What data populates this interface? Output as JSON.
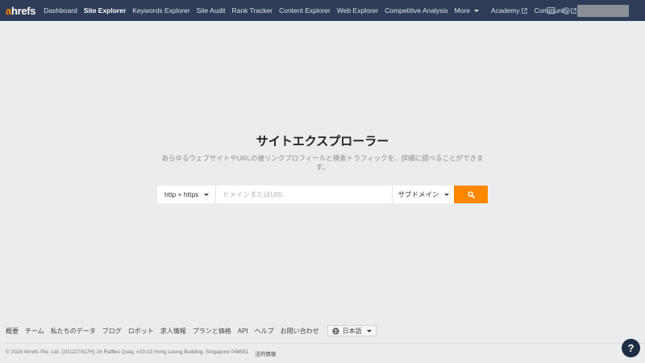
{
  "nav": {
    "logo_a": "a",
    "logo_rest": "hrefs",
    "items": [
      {
        "label": "Dashboard"
      },
      {
        "label": "Site Explorer"
      },
      {
        "label": "Keywords Explorer"
      },
      {
        "label": "Site Audit"
      },
      {
        "label": "Rank Tracker"
      },
      {
        "label": "Content Explorer"
      },
      {
        "label": "Web Explorer"
      },
      {
        "label": "Competitive Analysis"
      }
    ],
    "more_label": "More",
    "academy_label": "Academy",
    "community_label": "Community",
    "active_item": "Site Explorer"
  },
  "hero": {
    "title": "サイトエクスプローラー",
    "description": "あらゆるウェブサイトやURLの被リンクプロフィールと検索トラフィックを、詳細に調べることができます。"
  },
  "search": {
    "protocol": "http + https",
    "placeholder": "ドメインまたはURL",
    "value": "",
    "scope": "サブドメイン"
  },
  "footer": {
    "links": [
      {
        "label": "概要"
      },
      {
        "label": "チーム"
      },
      {
        "label": "私たちのデータ"
      },
      {
        "label": "ブログ"
      },
      {
        "label": "ロボット"
      },
      {
        "label": "求人情報"
      },
      {
        "label": "プランと価格"
      },
      {
        "label": "API"
      },
      {
        "label": "ヘルプ"
      },
      {
        "label": "お問い合わせ"
      }
    ],
    "language": "日本語",
    "copyright": "© 2024 Ahrefs Pte. Ltd. (201227417H) 16 Raffles Quay, #33-03 Hong Leong Building, Singapore 048581",
    "legal": "法的情報"
  },
  "help": {
    "label": "?"
  },
  "colors": {
    "nav_bg": "#2e3c57",
    "accent": "#ff8800",
    "page_bg": "#ebecee",
    "help_bg": "#1f2d44"
  },
  "icons": {
    "external": "external-link-icon",
    "monitor": "monitor-icon",
    "status": "status-icon",
    "search": "search-icon",
    "globe": "globe-icon"
  }
}
